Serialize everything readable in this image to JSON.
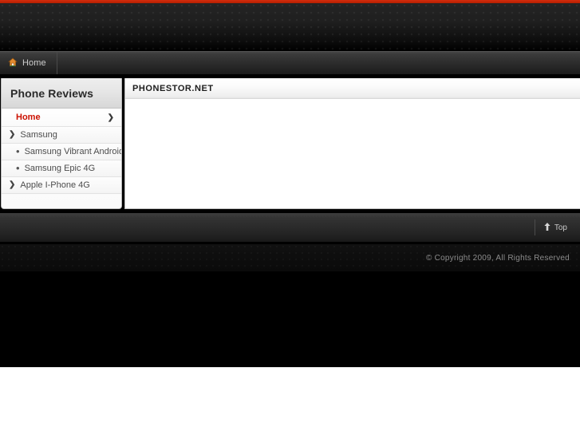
{
  "theme": {
    "accent_red": "#cc2200",
    "link_red": "#cc1100",
    "dark_bg": "#000000",
    "panel_bg": "#ffffff",
    "sidebar_bg": "#fbfbfb"
  },
  "navbar": {
    "items": [
      {
        "label": "Home",
        "icon": "home-icon"
      }
    ]
  },
  "sidebar": {
    "header": "Phone Reviews",
    "items": [
      {
        "label": "Home",
        "level": 1,
        "active": true,
        "marker": "none",
        "chevron": "❯"
      },
      {
        "label": "Samsung",
        "level": 1,
        "active": false,
        "marker": "arrow",
        "chevron": ""
      },
      {
        "label": "Samsung Vibrant Android",
        "level": 2,
        "active": false,
        "marker": "bullet",
        "chevron": ""
      },
      {
        "label": "Samsung Epic 4G",
        "level": 2,
        "active": false,
        "marker": "bullet",
        "chevron": ""
      },
      {
        "label": "Apple I-Phone 4G",
        "level": 1,
        "active": false,
        "marker": "arrow",
        "chevron": ""
      }
    ],
    "marker_glyphs": {
      "arrow": "❯",
      "bullet": "•"
    }
  },
  "main": {
    "title": "PHONESTOR.NET",
    "body_text": ""
  },
  "footer": {
    "top_label": "Top",
    "top_icon": "arrow-up-icon",
    "copyright": "© Copyright 2009, All Rights Reserved"
  }
}
